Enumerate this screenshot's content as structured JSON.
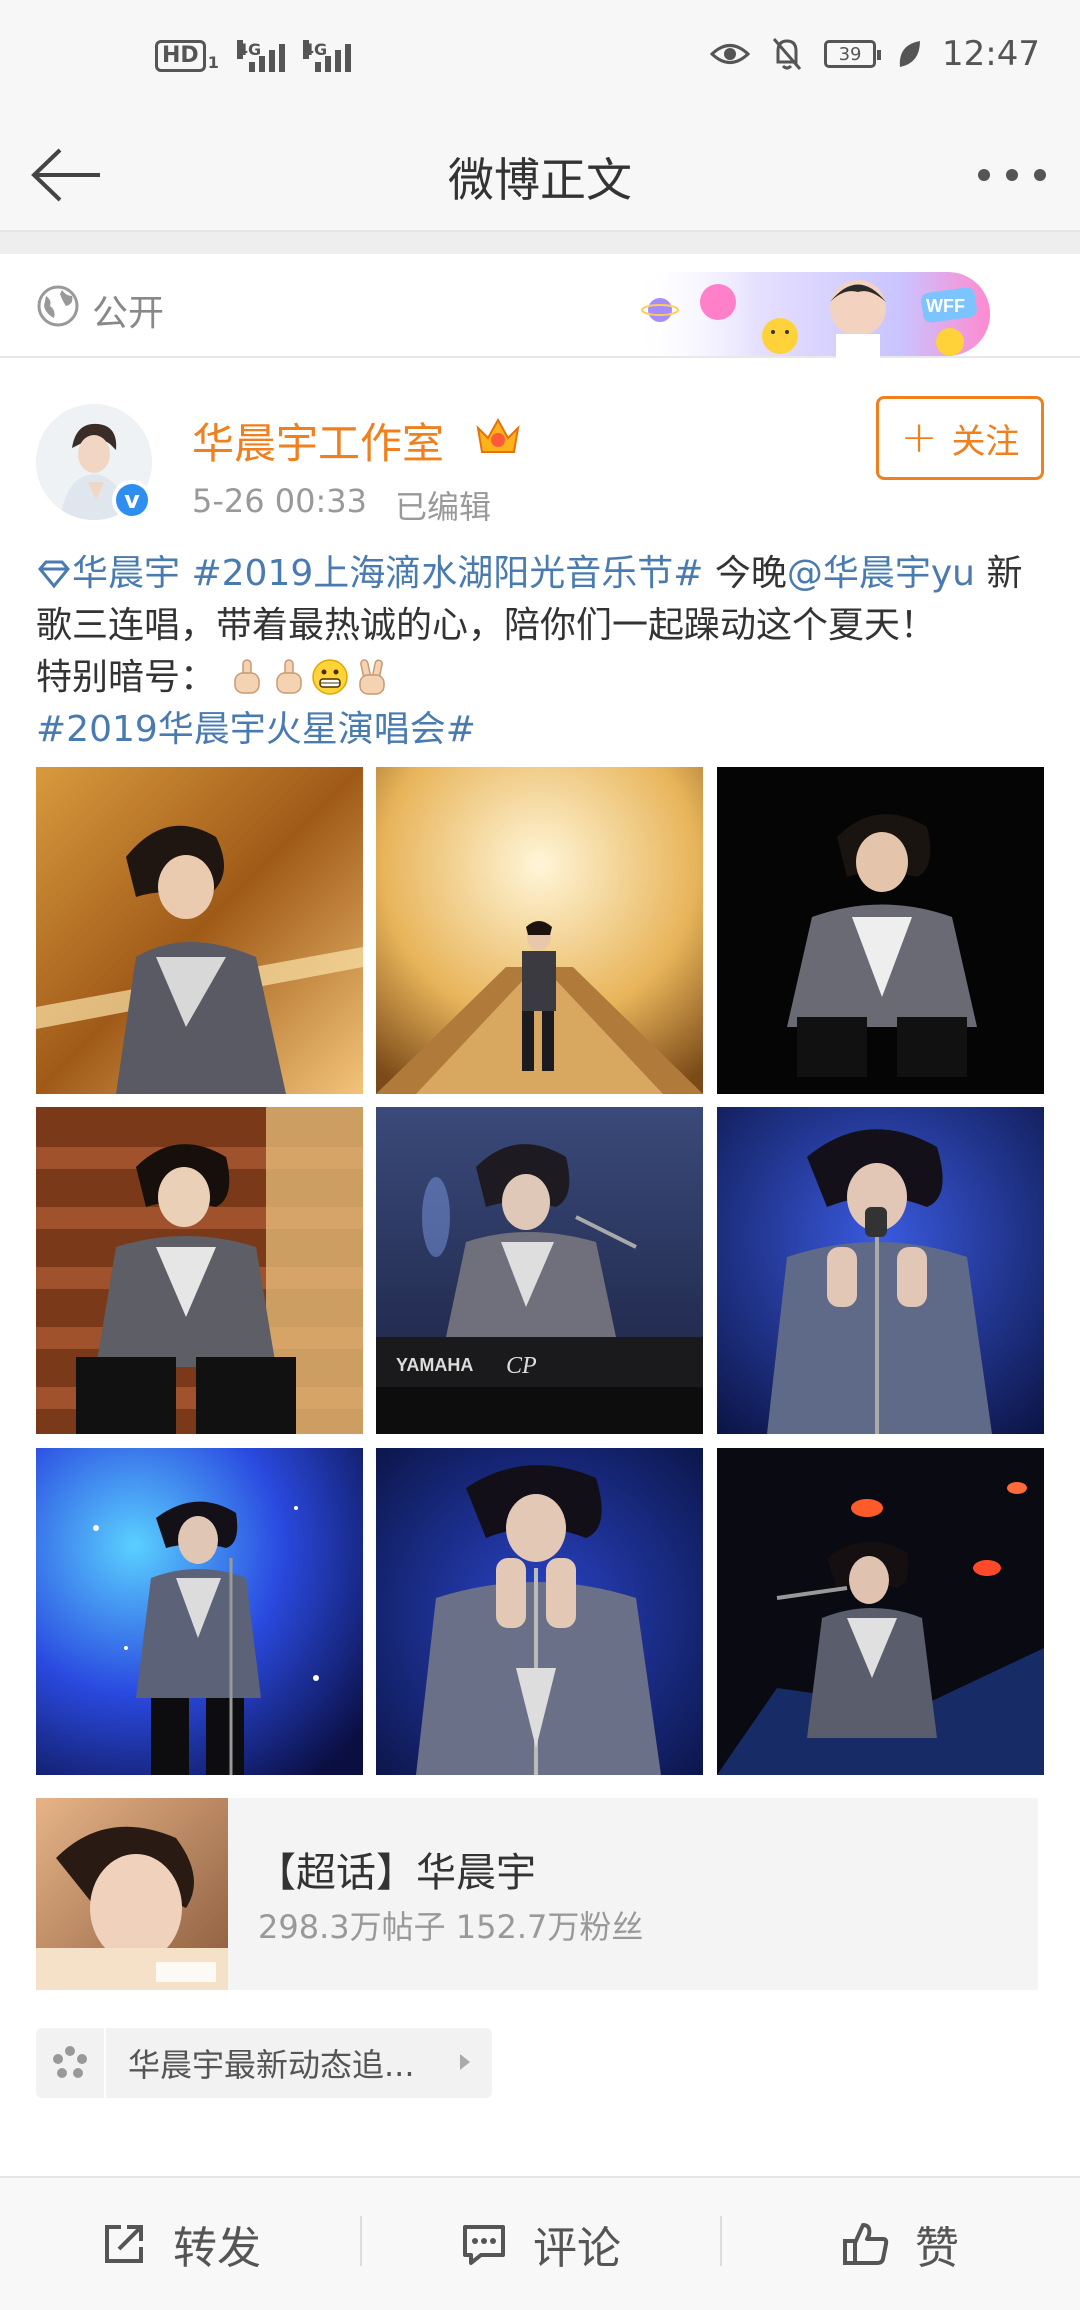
{
  "status_bar": {
    "hd_label": "HD",
    "sim_label": "1",
    "signal_labels": [
      "4G",
      "4G"
    ],
    "battery": "39",
    "time": "12:47",
    "icons": [
      "eye-icon",
      "mute-bell-icon",
      "battery-icon",
      "leaf-icon"
    ]
  },
  "nav": {
    "title": "微博正文",
    "back_icon": "back-arrow-icon",
    "more_icon": "more-dots-icon"
  },
  "visibility": {
    "label": "公开",
    "banner_text": "WFF"
  },
  "author": {
    "name": "华晨宇工作室",
    "verified_mark": "v",
    "time": "5-26 00:33",
    "edited": "已编辑",
    "follow_label": "关注"
  },
  "post": {
    "superTopic": "华晨宇",
    "hashtag1": "#2019上海滴水湖阳光音乐节#",
    "text1": " 今晚",
    "mention": "@华晨宇yu",
    "text2": " 新歌三连唱，带着最热诚的心，陪你们一起躁动这个夏天！",
    "text3": "特别暗号：",
    "hashtag2": "#2019华晨宇火星演唱会#",
    "emojis": [
      "finger-point-up-emoji",
      "finger-point-up-emoji",
      "grimacing-face-emoji",
      "victory-hand-emoji"
    ]
  },
  "photos": [
    {
      "theme": "warm-gold"
    },
    {
      "theme": "golden-hall"
    },
    {
      "theme": "black-studio"
    },
    {
      "theme": "wood-stairs"
    },
    {
      "theme": "stage-keyboard"
    },
    {
      "theme": "blue-stage"
    },
    {
      "theme": "galaxy-blue"
    },
    {
      "theme": "deep-blue"
    },
    {
      "theme": "red-lights"
    }
  ],
  "keyboard_text": {
    "brand": "YAMAHA",
    "model": "CP"
  },
  "topic": {
    "title": "【超话】华晨宇",
    "stats": "298.3万帖子 152.7万粉丝"
  },
  "location": {
    "label": "华晨宇最新动态追..."
  },
  "bottom": {
    "repost": "转发",
    "comment": "评论",
    "like": "赞"
  },
  "colors": {
    "accent": "#f0801e",
    "link": "#4a7bb0",
    "verified": "#2e8ef0"
  }
}
